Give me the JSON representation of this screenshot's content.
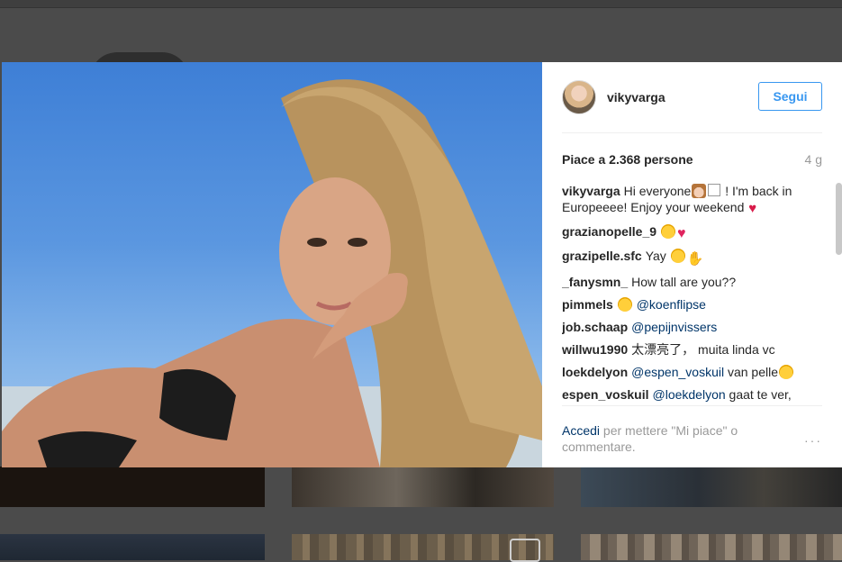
{
  "post": {
    "username": "vikyvarga",
    "follow_label": "Segui",
    "likes_text": "Piace a 2.368 persone",
    "time_ago": "4 g"
  },
  "comments": [
    {
      "user": "vikyvarga",
      "parts": [
        {
          "t": "text",
          "v": "Hi everyone"
        },
        {
          "t": "emoji",
          "v": "girl-emoji"
        },
        {
          "t": "emoji",
          "v": "box-emoji"
        },
        {
          "t": "text",
          "v": " ! I'm back in Europeeee! Enjoy your weekend "
        },
        {
          "t": "emoji",
          "v": "kiss-emoji"
        }
      ]
    },
    {
      "user": "grazianopelle_9",
      "parts": [
        {
          "t": "emoji",
          "v": "heart-eyes-emoji"
        },
        {
          "t": "emoji",
          "v": "heart-emoji"
        }
      ]
    },
    {
      "user": "grazipelle.sfc",
      "parts": [
        {
          "t": "text",
          "v": "Yay "
        },
        {
          "t": "emoji",
          "v": "heart-eyes-emoji"
        },
        {
          "t": "emoji",
          "v": "raised-hands-emoji"
        }
      ]
    },
    {
      "user": "_fanysmn_",
      "parts": [
        {
          "t": "text",
          "v": "How tall are you??"
        }
      ]
    },
    {
      "user": "pimmels",
      "parts": [
        {
          "t": "emoji",
          "v": "heart-eyes-emoji"
        },
        {
          "t": "text",
          "v": " "
        },
        {
          "t": "mention",
          "v": "@koenflipse"
        }
      ]
    },
    {
      "user": "job.schaap",
      "parts": [
        {
          "t": "mention",
          "v": "@pepijnvissers"
        }
      ]
    },
    {
      "user": "willwu1990",
      "parts": [
        {
          "t": "text",
          "v": "太漂亮了， muita linda vc"
        }
      ]
    },
    {
      "user": "loekdelyon",
      "parts": [
        {
          "t": "mention",
          "v": "@espen_voskuil"
        },
        {
          "t": "text",
          "v": " van pelle"
        },
        {
          "t": "emoji",
          "v": "heart-eyes-emoji"
        }
      ]
    },
    {
      "user": "espen_voskuil",
      "parts": [
        {
          "t": "mention",
          "v": "@loekdelyon"
        },
        {
          "t": "text",
          "v": " gaat te ver, toch die van karsdorp beter"
        }
      ]
    }
  ],
  "footer": {
    "login_label": "Accedi",
    "rest_text": " per mettere \"Mi piace\" o commentare.",
    "more_icon": "···"
  },
  "colors": {
    "accent": "#3897f0",
    "link": "#003569",
    "muted": "#999999"
  }
}
